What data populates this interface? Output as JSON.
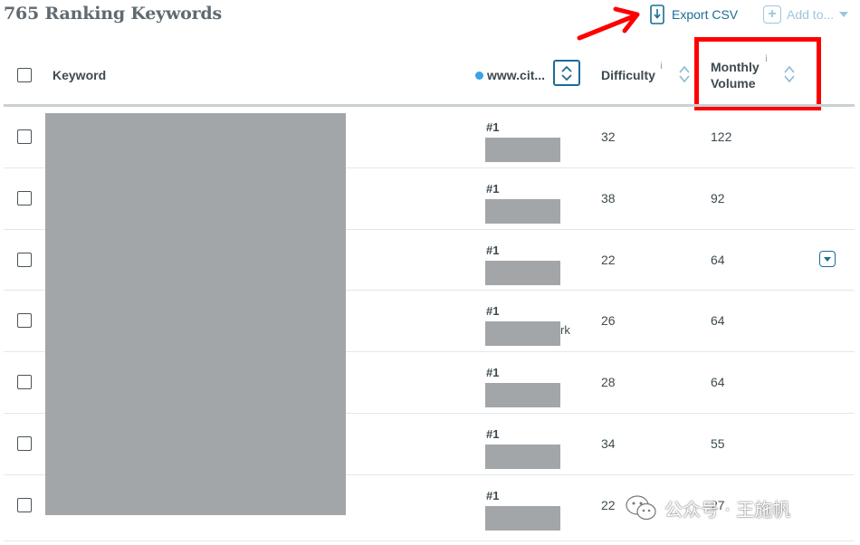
{
  "header": {
    "title": "765 Ranking Keywords",
    "export_label": "Export CSV",
    "add_to_label": "Add to..."
  },
  "columns": {
    "keyword": "Keyword",
    "site": "www.cit...",
    "difficulty": "Difficulty",
    "volume_line1": "Monthly",
    "volume_line2": "Volume",
    "info": "i"
  },
  "rows": [
    {
      "rank": "#1",
      "difficulty": "32",
      "volume": "122",
      "site_fragment": ""
    },
    {
      "rank": "#1",
      "difficulty": "38",
      "volume": "92",
      "site_fragment": ""
    },
    {
      "rank": "#1",
      "difficulty": "22",
      "volume": "64",
      "site_fragment": ""
    },
    {
      "rank": "#1",
      "difficulty": "26",
      "volume": "64",
      "site_fragment": "rk"
    },
    {
      "rank": "#1",
      "difficulty": "28",
      "volume": "64",
      "site_fragment": ""
    },
    {
      "rank": "#1",
      "difficulty": "34",
      "volume": "55",
      "site_fragment": ""
    },
    {
      "rank": "#1",
      "difficulty": "22",
      "volume": "27",
      "site_fragment": ""
    }
  ],
  "watermark": "公众号 · 王施帆",
  "colors": {
    "accent": "#1b6c97",
    "annotation_red": "#ff0000",
    "redaction": "#a3a6a8",
    "site_dot": "#3aa3e3"
  }
}
